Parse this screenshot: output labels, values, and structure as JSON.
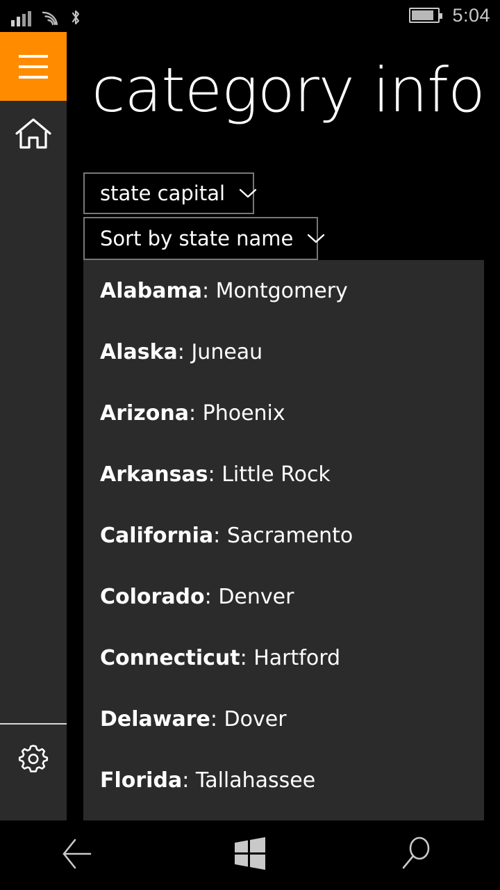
{
  "status_bar": {
    "signal_icon": "cellular-signal-icon",
    "signal_bars_total": 4,
    "signal_bars_active": 2,
    "wifi_icon": "wifi-icon",
    "bluetooth_icon": "bluetooth-icon",
    "battery_icon": "battery-icon",
    "battery_level_percent": 85,
    "time": "5:04"
  },
  "rail": {
    "menu_button": {
      "icon": "hamburger-menu-icon",
      "accent_color": "#FF8C00"
    },
    "home_button": {
      "icon": "home-icon"
    },
    "settings_button": {
      "icon": "gear-icon"
    }
  },
  "header": {
    "title": "category info"
  },
  "controls": {
    "category_dropdown": {
      "value": "state capital",
      "chevron": "chevron-down-icon"
    },
    "sort_dropdown": {
      "value": "Sort by state name",
      "chevron": "chevron-down-icon"
    }
  },
  "list": {
    "separator": ": ",
    "items": [
      {
        "state": "Alabama",
        "capital": "Montgomery"
      },
      {
        "state": "Alaska",
        "capital": "Juneau"
      },
      {
        "state": "Arizona",
        "capital": "Phoenix"
      },
      {
        "state": "Arkansas",
        "capital": "Little Rock"
      },
      {
        "state": "California",
        "capital": "Sacramento"
      },
      {
        "state": "Colorado",
        "capital": "Denver"
      },
      {
        "state": "Connecticut",
        "capital": "Hartford"
      },
      {
        "state": "Delaware",
        "capital": "Dover"
      },
      {
        "state": "Florida",
        "capital": "Tallahassee"
      }
    ]
  },
  "nav_bar": {
    "back_icon": "back-arrow-icon",
    "start_icon": "windows-start-icon",
    "search_icon": "search-icon"
  },
  "colors": {
    "background": "#000000",
    "panel": "#2b2b2b",
    "accent": "#FF8C00",
    "border": "#787878",
    "icon": "#c9c9c9",
    "text": "#ffffff"
  }
}
